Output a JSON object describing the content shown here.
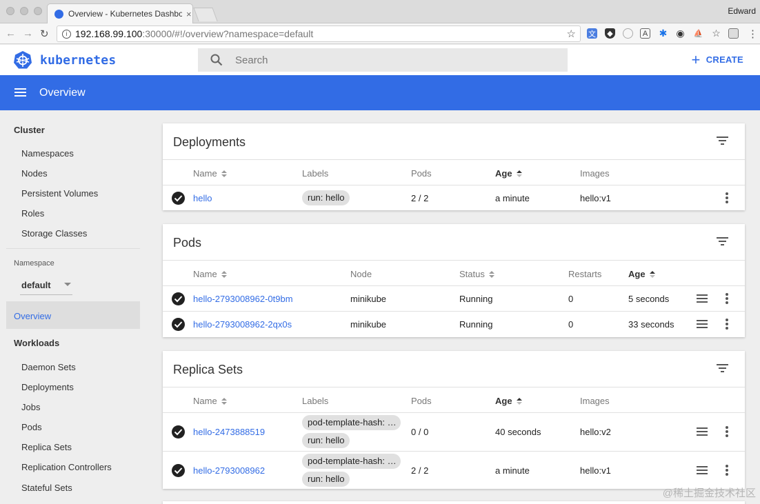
{
  "browser": {
    "tab_title": "Overview - Kubernetes Dashboard",
    "tab_close": "×",
    "profile_name": "Edward",
    "url_host": "192.168.99.100",
    "url_path": ":30000/#!/overview?namespace=default",
    "info_glyph": "i",
    "star_glyph": "☆",
    "back_glyph": "←",
    "forward_glyph": "→",
    "reload_glyph": "↻",
    "menu_glyph": "⋮",
    "extension_icons": [
      "translate-icon",
      "shield-icon",
      "circle-icon",
      "a-icon",
      "snowflake-icon",
      "record-icon",
      "boat-icon",
      "star-extension-icon",
      "square-icon"
    ]
  },
  "header": {
    "brand": "kubernetes",
    "search_placeholder": "Search",
    "create_label": "CREATE",
    "create_glyph": "+"
  },
  "toolbar": {
    "title": "Overview"
  },
  "sidebar": {
    "cluster_heading": "Cluster",
    "cluster_items": [
      "Namespaces",
      "Nodes",
      "Persistent Volumes",
      "Roles",
      "Storage Classes"
    ],
    "namespace_label": "Namespace",
    "namespace_value": "default",
    "active_item": "Overview",
    "workloads_heading": "Workloads",
    "workload_items": [
      "Daemon Sets",
      "Deployments",
      "Jobs",
      "Pods",
      "Replica Sets",
      "Replication Controllers",
      "Stateful Sets"
    ]
  },
  "deployments": {
    "title": "Deployments",
    "headers": {
      "name": "Name",
      "labels": "Labels",
      "pods": "Pods",
      "age": "Age",
      "images": "Images"
    },
    "rows": [
      {
        "name": "hello",
        "label": "run: hello",
        "pods": "2 / 2",
        "age": "a minute",
        "image": "hello:v1"
      }
    ]
  },
  "pods": {
    "title": "Pods",
    "headers": {
      "name": "Name",
      "node": "Node",
      "status": "Status",
      "restarts": "Restarts",
      "age": "Age"
    },
    "rows": [
      {
        "name": "hello-2793008962-0t9bm",
        "node": "minikube",
        "status": "Running",
        "restarts": "0",
        "age": "5 seconds"
      },
      {
        "name": "hello-2793008962-2qx0s",
        "node": "minikube",
        "status": "Running",
        "restarts": "0",
        "age": "33 seconds"
      }
    ]
  },
  "replicasets": {
    "title": "Replica Sets",
    "headers": {
      "name": "Name",
      "labels": "Labels",
      "pods": "Pods",
      "age": "Age",
      "images": "Images"
    },
    "rows": [
      {
        "name": "hello-2473888519",
        "label1": "pod-template-hash: …",
        "label2": "run: hello",
        "pods": "0 / 0",
        "age": "40 seconds",
        "image": "hello:v2"
      },
      {
        "name": "hello-2793008962",
        "label1": "pod-template-hash: …",
        "label2": "run: hello",
        "pods": "2 / 2",
        "age": "a minute",
        "image": "hello:v1"
      }
    ]
  },
  "watermark": "@稀土掘金技术社区",
  "colors": {
    "accent": "#326ce5",
    "toolbar": "#326ce5",
    "background": "#eeeeee"
  }
}
